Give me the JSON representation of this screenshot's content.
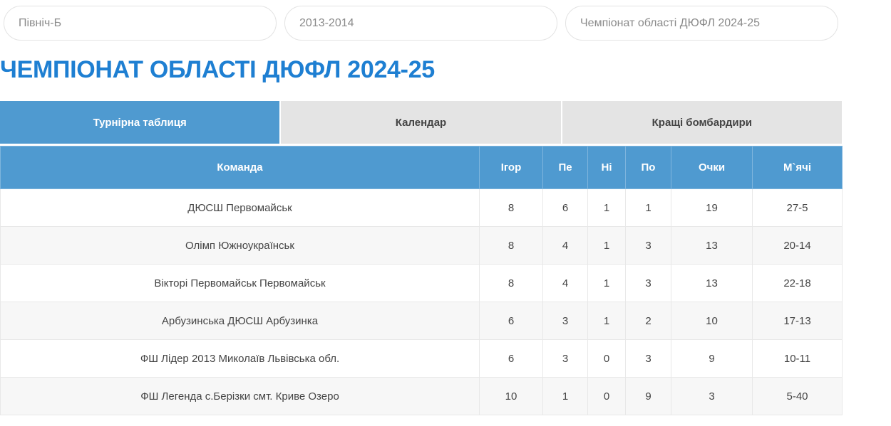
{
  "filters": [
    {
      "value": "Північ-Б"
    },
    {
      "value": "2013-2014"
    },
    {
      "value": "Чемпіонат області ДЮФЛ 2024-25"
    }
  ],
  "page_title": "ЧЕМПІОНАТ ОБЛАСТІ ДЮФЛ 2024-25",
  "tabs": [
    {
      "label": "Турнірна таблиця",
      "active": true
    },
    {
      "label": "Календар",
      "active": false
    },
    {
      "label": "Кращі бомбардири",
      "active": false
    }
  ],
  "table": {
    "headers": [
      "Команда",
      "Ігор",
      "Пе",
      "Ні",
      "По",
      "Очки",
      "М`ячі"
    ],
    "rows": [
      [
        "ДЮСШ Первомайськ",
        "8",
        "6",
        "1",
        "1",
        "19",
        "27-5"
      ],
      [
        "Олімп Южноукраїнськ",
        "8",
        "4",
        "1",
        "3",
        "13",
        "20-14"
      ],
      [
        "Вікторі Первомайськ Первомайськ",
        "8",
        "4",
        "1",
        "3",
        "13",
        "22-18"
      ],
      [
        "Арбузинська ДЮСШ Арбузинка",
        "6",
        "3",
        "1",
        "2",
        "10",
        "17-13"
      ],
      [
        "ФШ Лідер 2013 Миколаїв Львівська обл.",
        "6",
        "3",
        "0",
        "3",
        "9",
        "10-11"
      ],
      [
        "ФШ Легенда с.Берізки смт. Криве Озеро",
        "10",
        "1",
        "0",
        "9",
        "3",
        "5-40"
      ]
    ]
  },
  "colors": {
    "accent": "#1e7fd2",
    "header_bg": "#4f9ad0",
    "tab_inactive_bg": "#e4e4e4"
  }
}
